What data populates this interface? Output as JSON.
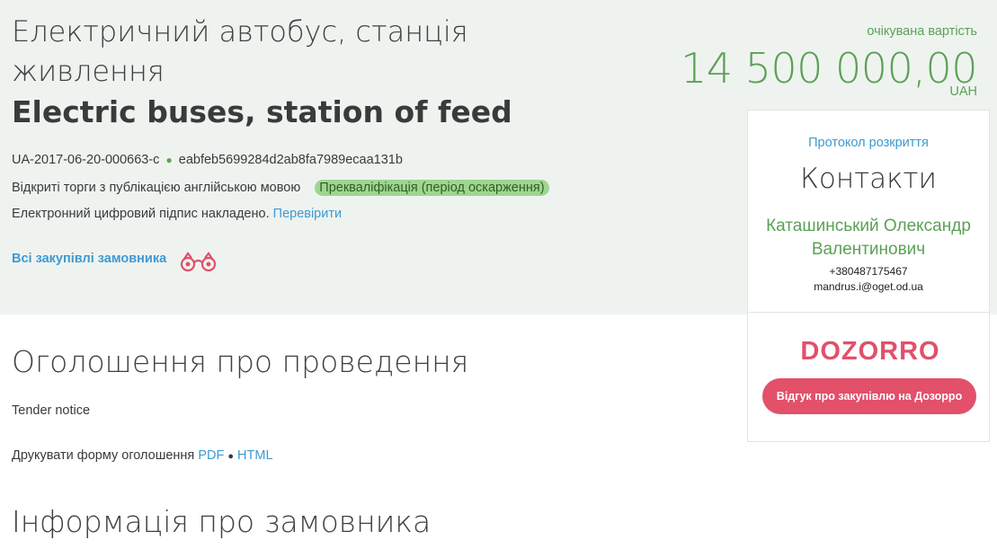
{
  "tender": {
    "title_ua": "Електричний автобус, станція живлення",
    "title_en": "Electric buses, station of feed",
    "id": "UA-2017-06-20-000663-c",
    "hash": "eabfeb5699284d2ab8fa7989ecaa131b",
    "procedure_type": "Відкриті торги з публікацією англійською мовою",
    "status_badge": "Прекваліфікація (період оскарження)",
    "signature_text": "Електронний цифровий підпис накладено.",
    "signature_link": "Перевірити",
    "all_purchases_link": "Всі закупівлі замовника"
  },
  "price": {
    "label": "очікувана вартість",
    "value": "14 500 000,00",
    "currency": "UAH"
  },
  "sidebar": {
    "protocol_link": "Протокол розкриття",
    "contacts_title": "Контакти",
    "contact_name": "Каташинський Олександр Валентинович",
    "phone": "+380487175467",
    "email": "mandrus.i@oget.od.ua",
    "dozorro_logo_text": "DOZORRO",
    "dozorro_button": "Відгук про закупівлю на Дозорро"
  },
  "sections": {
    "notice_title": "Оголошення про проведення",
    "notice_subtitle": "Tender notice",
    "print_form_label": "Друкувати форму оголошення",
    "print_pdf": "PDF",
    "print_separator": "●",
    "print_html": "HTML",
    "customer_title": "Інформація про замовника"
  },
  "colors": {
    "accent_green": "#5ba155",
    "link_blue": "#3d9ad1",
    "dozorro_red": "#e2506a",
    "header_bg": "#eff3f0"
  }
}
